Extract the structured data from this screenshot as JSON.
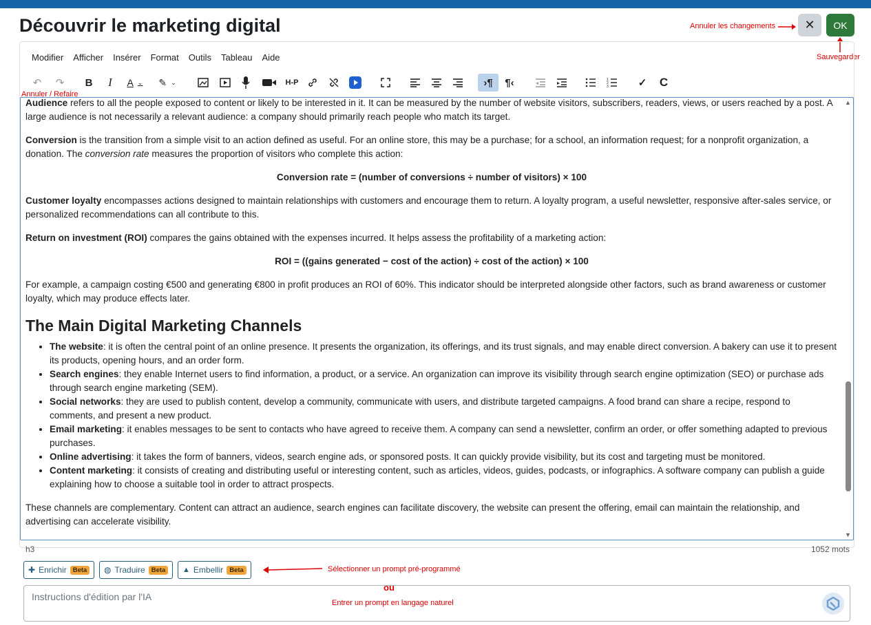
{
  "header": {
    "title": "Découvrir le marketing digital",
    "close_label": "✕",
    "ok_label": "OK"
  },
  "annotations": {
    "cancel_changes": "Annuler les changements",
    "save": "Sauvegarder",
    "undo_redo": "Annuler / Refaire",
    "select_prompt": "Sélectionner un prompt pré-programmé",
    "or": "ou",
    "natural_prompt": "Entrer un prompt en langage naturel"
  },
  "menu": [
    "Modifier",
    "Afficher",
    "Insérer",
    "Format",
    "Outils",
    "Tableau",
    "Aide"
  ],
  "toolbar_icons": [
    "undo-icon",
    "redo-icon",
    "bold-icon",
    "italic-icon",
    "text-color-icon",
    "highlight-icon",
    "image-icon",
    "media-icon",
    "microphone-icon",
    "video-icon",
    "h5p-icon",
    "link-icon",
    "unlink-icon",
    "multimedia-icon",
    "fullscreen-icon",
    "align-left-icon",
    "align-center-icon",
    "align-right-icon",
    "ltr-icon",
    "rtl-icon",
    "outdent-icon",
    "indent-icon",
    "bullet-list-icon",
    "numbered-list-icon",
    "check-icon",
    "clear-icon"
  ],
  "content": {
    "p1_bold": "Audience",
    "p1_rest": " refers to all the people exposed to content or likely to be interested in it. It can be measured by the number of website visitors, subscribers, readers, views, or users reached by a post. A large audience is not necessarily a relevant audience: a company should primarily reach people who match its target.",
    "p2_bold": "Conversion",
    "p2_mid": " is the transition from a simple visit to an action defined as useful. For an online store, this may be a purchase; for a school, an information request; for a nonprofit organization, a donation. The ",
    "p2_italic": "conversion rate",
    "p2_end": " measures the proportion of visitors who complete this action:",
    "formula1": "Conversion rate = (number of conversions ÷ number of visitors) × 100",
    "p3_bold": "Customer loyalty",
    "p3_rest": " encompasses actions designed to maintain relationships with customers and encourage them to return. A loyalty program, a useful newsletter, responsive after-sales service, or personalized recommendations can all contribute to this.",
    "p4_bold": "Return on investment (ROI)",
    "p4_rest": " compares the gains obtained with the expenses incurred. It helps assess the profitability of a marketing action:",
    "formula2": "ROI = ((gains generated − cost of the action) ÷ cost of the action) × 100",
    "p5": "For example, a campaign costing €500 and generating €800 in profit produces an ROI of 60%. This indicator should be interpreted alongside other factors, such as brand awareness or customer loyalty, which may produce effects later.",
    "heading": "The Main Digital Marketing Channels",
    "list": [
      {
        "bold": "The website",
        "text": ": it is often the central point of an online presence. It presents the organization, its offerings, and its trust signals, and may enable direct conversion. A bakery can use it to present its products, opening hours, and an order form."
      },
      {
        "bold": "Search engines",
        "text": ": they enable Internet users to find information, a product, or a service. An organization can improve its visibility through search engine optimization (SEO) or purchase ads through search engine marketing (SEM)."
      },
      {
        "bold": "Social networks",
        "text": ": they are used to publish content, develop a community, communicate with users, and distribute targeted campaigns. A food brand can share a recipe, respond to comments, and present a new product."
      },
      {
        "bold": "Email marketing",
        "text": ": it enables messages to be sent to contacts who have agreed to receive them. A company can send a newsletter, confirm an order, or offer something adapted to previous purchases."
      },
      {
        "bold": "Online advertising",
        "text": ": it takes the form of banners, videos, search engine ads, or sponsored posts. It can quickly provide visibility, but its cost and targeting must be monitored."
      },
      {
        "bold": "Content marketing",
        "text": ": it consists of creating and distributing useful or interesting content, such as articles, videos, guides, podcasts, or infographics. A software company can publish a guide explaining how to choose a suitable tool in order to attract prospects."
      }
    ],
    "p6": "These channels are complementary. Content can attract an audience, search engines can facilitate discovery, the website can present the offering, email can maintain the relationship, and advertising can accelerate visibility."
  },
  "status": {
    "element": "h3",
    "word_count": "1052 mots"
  },
  "prompt_buttons": [
    {
      "label": "Enrichir",
      "badge": "Beta"
    },
    {
      "label": "Traduire",
      "badge": "Beta"
    },
    {
      "label": "Embellir",
      "badge": "Beta"
    }
  ],
  "prompt_input": {
    "placeholder": "Instructions d'édition par l'IA"
  }
}
